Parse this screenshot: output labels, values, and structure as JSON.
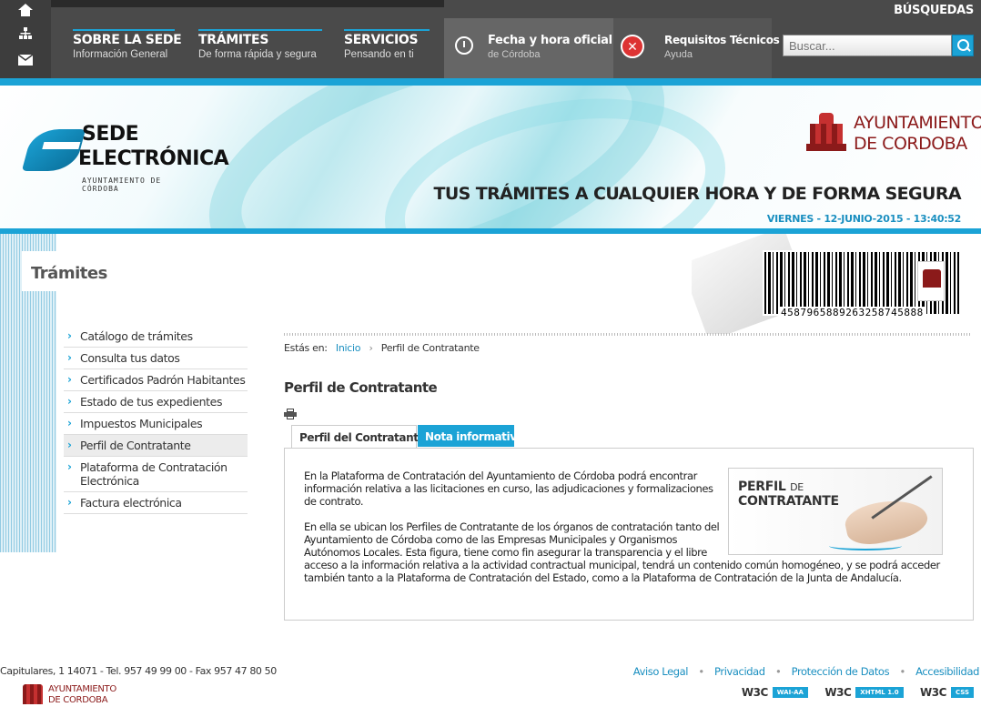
{
  "topbar": {
    "icons": [
      "home-icon",
      "sitemap-icon",
      "mail-icon"
    ],
    "nav": [
      {
        "title": "SOBRE LA SEDE",
        "subtitle": "Información General"
      },
      {
        "title": "TRÁMITES",
        "subtitle": "De forma rápida y segura"
      },
      {
        "title": "SERVICIOS",
        "subtitle": "Pensando en ti"
      }
    ],
    "fecha": {
      "title": "Fecha y hora oficial",
      "subtitle": "de Córdoba"
    },
    "requisitos": {
      "title": "Requisitos Técnicos",
      "subtitle": "Ayuda"
    },
    "busquedas_label": "BÚSQUEDAS",
    "search_placeholder": "Buscar..."
  },
  "banner": {
    "sede_line1": "SEDE",
    "sede_line2": "ELECTRÓNICA",
    "sede_line3": "AYUNTAMIENTO DE CÓRDOBA",
    "ayto_line1": "AYUNTAMIENTO",
    "ayto_line2": "DE CORDOBA",
    "slogan": "TUS TRÁMITES A CUALQUIER HORA Y DE FORMA SEGURA",
    "date": "VIERNES - 12-JUNIO-2015 - 13:40:52",
    "barcode_number": "4587965889263258745888"
  },
  "sidebar": {
    "heading": "Trámites",
    "items": [
      {
        "label": "Catálogo de trámites"
      },
      {
        "label": "Consulta tus datos"
      },
      {
        "label": "Certificados Padrón Habitantes"
      },
      {
        "label": "Estado de tus expedientes"
      },
      {
        "label": "Impuestos Municipales"
      },
      {
        "label": "Perfil de Contratante"
      },
      {
        "label": "Plataforma de Contratación Electrónica"
      },
      {
        "label": "Factura electrónica"
      }
    ],
    "active_index": 5
  },
  "main": {
    "breadcrumb_prefix": "Estás en:",
    "breadcrumb_home": "Inicio",
    "breadcrumb_sep": "›",
    "breadcrumb_current": "Perfil de Contratante",
    "title": "Perfil de Contratante",
    "tabs": [
      {
        "label": "Perfil del Contratante"
      },
      {
        "label": "Nota informativa"
      }
    ],
    "para1": "En la Plataforma de Contratación del Ayuntamiento de Córdoba podrá encontrar información relativa a las licitaciones en curso, las adjudicaciones y formalizaciones de contrato.",
    "para2": "En ella se ubican los Perfiles de Contratante de los órganos de contratación tanto del Ayuntamiento de Córdoba como de las Empresas Municipales y Organismos Autónomos Locales. Esta figura, tiene como fin asegurar la transparencia y el libre",
    "para3": "acceso a la información relativa a la actividad contractual municipal, tendrá un contenido común homogéneo, y se podrá acceder también tanto a la Plataforma de Contratación del Estado, como a la Plataforma de Contratación de la Junta de Andalucía.",
    "image_line1_big": "PERFIL",
    "image_line1_small": "DE",
    "image_line2": "CONTRATANTE"
  },
  "footer": {
    "address": "Capitulares, 1 14071 - Tel. 957 49 99 00 - Fax 957 47 80 50",
    "ayto_line1": "AYUNTAMIENTO",
    "ayto_line2": "DE CORDOBA",
    "links": [
      {
        "label": "Aviso Legal"
      },
      {
        "label": "Privacidad"
      },
      {
        "label": "Protección de Datos"
      },
      {
        "label": "Accesibilidad"
      }
    ],
    "w3c": [
      {
        "mark": "W3C",
        "badge": "WAI-AA"
      },
      {
        "mark": "W3C",
        "badge": "XHTML 1.0"
      },
      {
        "mark": "W3C",
        "badge": "CSS"
      }
    ]
  },
  "colors": {
    "accent": "#1ba3d6",
    "topbar": "#4a4a4a",
    "brand_red": "#8b1a1a"
  }
}
